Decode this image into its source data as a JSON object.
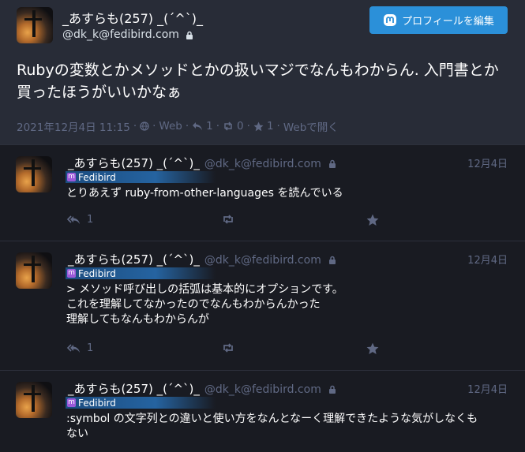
{
  "main": {
    "display_name": "_あすらも(257) _(´^`)_",
    "account": "@dk_k@fedibird.com",
    "profile_button": "プロフィールを編集",
    "text": "Rubyの変数とかメソッドとかの扱いマジでなんもわからん. 入門書とか買ったほうがいいかなぁ",
    "meta": {
      "timestamp": "2021年12月4日 11:15",
      "sep": "·",
      "app": "Web",
      "replies": "1",
      "boosts": "0",
      "favourites": "1",
      "open_web": "Webで開く"
    }
  },
  "replies": [
    {
      "display_name": "_あすらも(257) _(´^`)_",
      "account": "@dk_k@fedibird.com",
      "date": "12月4日",
      "badge": "Fedibird",
      "lines": [
        "とりあえず ruby-from-other-languages を読んでいる"
      ],
      "reply_count": "1"
    },
    {
      "display_name": "_あすらも(257) _(´^`)_",
      "account": "@dk_k@fedibird.com",
      "date": "12月4日",
      "badge": "Fedibird",
      "lines": [
        "> メソッド呼び出しの括弧は基本的にオプションです。",
        "これを理解してなかったのでなんもわからんかった",
        "理解してもなんもわからんが"
      ],
      "reply_count": "1"
    },
    {
      "display_name": "_あすらも(257) _(´^`)_",
      "account": "@dk_k@fedibird.com",
      "date": "12月4日",
      "badge": "Fedibird",
      "lines": [
        ":symbol の文字列との違いと使い方をなんとなーく理解できたような気がしなくも",
        "ない"
      ],
      "reply_count": ""
    }
  ],
  "colors": {
    "accent": "#2b90d9",
    "muted": "#606984",
    "bg": "#191b22",
    "panel": "#282c37"
  }
}
